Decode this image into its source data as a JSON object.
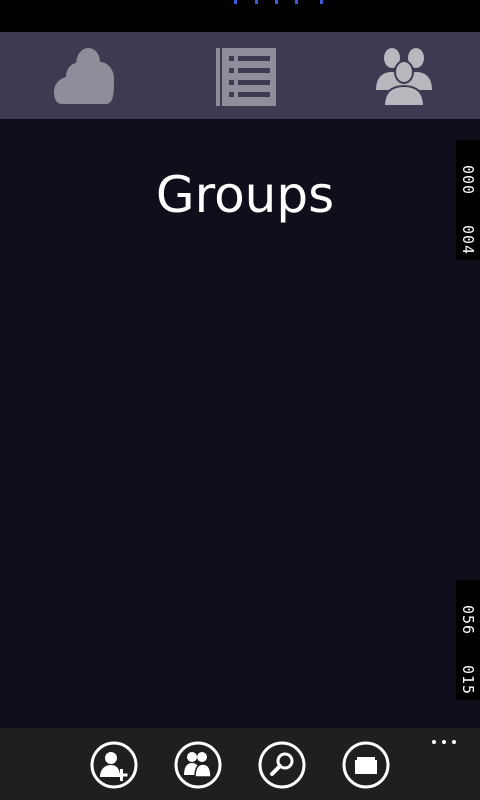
{
  "colors": {
    "background": "#0f0e1a",
    "header": "#3c3b52",
    "header_icon": "#b8b8be",
    "header_icon_dim": "#8e8d9a",
    "app_bar": "#1f1f1f",
    "progress_dots": "#3b5bdb"
  },
  "status_bar": {
    "progress_icon": "progress-dots"
  },
  "header": {
    "tabs": [
      {
        "icon": "cloud-icon"
      },
      {
        "icon": "list-icon"
      },
      {
        "icon": "groups-icon"
      }
    ]
  },
  "main": {
    "title": "Groups"
  },
  "side_indicators": {
    "top": [
      "000",
      "004"
    ],
    "bottom": [
      "056",
      "015"
    ]
  },
  "app_bar": {
    "buttons": [
      {
        "icon": "add-contact-icon"
      },
      {
        "icon": "people-icon"
      },
      {
        "icon": "search-icon"
      },
      {
        "icon": "folder-icon"
      }
    ],
    "more_icon": "ellipsis-icon"
  }
}
